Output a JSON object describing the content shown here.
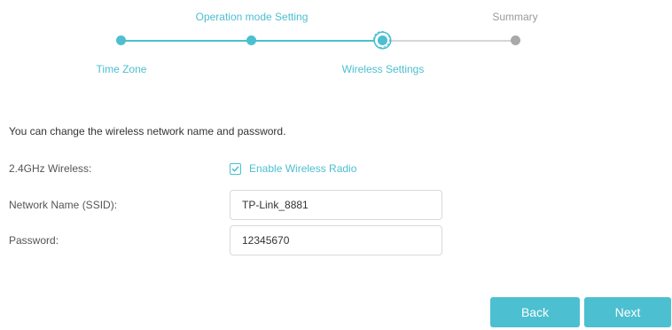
{
  "wizard": {
    "steps": [
      {
        "label": "Time Zone",
        "status": "done"
      },
      {
        "label": "Operation mode Setting",
        "status": "done"
      },
      {
        "label": "Wireless Settings",
        "status": "current"
      },
      {
        "label": "Summary",
        "status": "pending"
      }
    ]
  },
  "form": {
    "intro": "You can change the wireless network name and password.",
    "wireless_band_label": "2.4GHz Wireless:",
    "enable_radio_label": "Enable Wireless Radio",
    "enable_radio_checked": true,
    "ssid_label": "Network Name (SSID):",
    "ssid_value": "TP-Link_8881",
    "password_label": "Password:",
    "password_value": "12345670"
  },
  "actions": {
    "back_label": "Back",
    "next_label": "Next"
  },
  "colors": {
    "accent": "#4cbfd0",
    "pending": "#a9a9a9",
    "track_pending": "#d6d6d6"
  }
}
